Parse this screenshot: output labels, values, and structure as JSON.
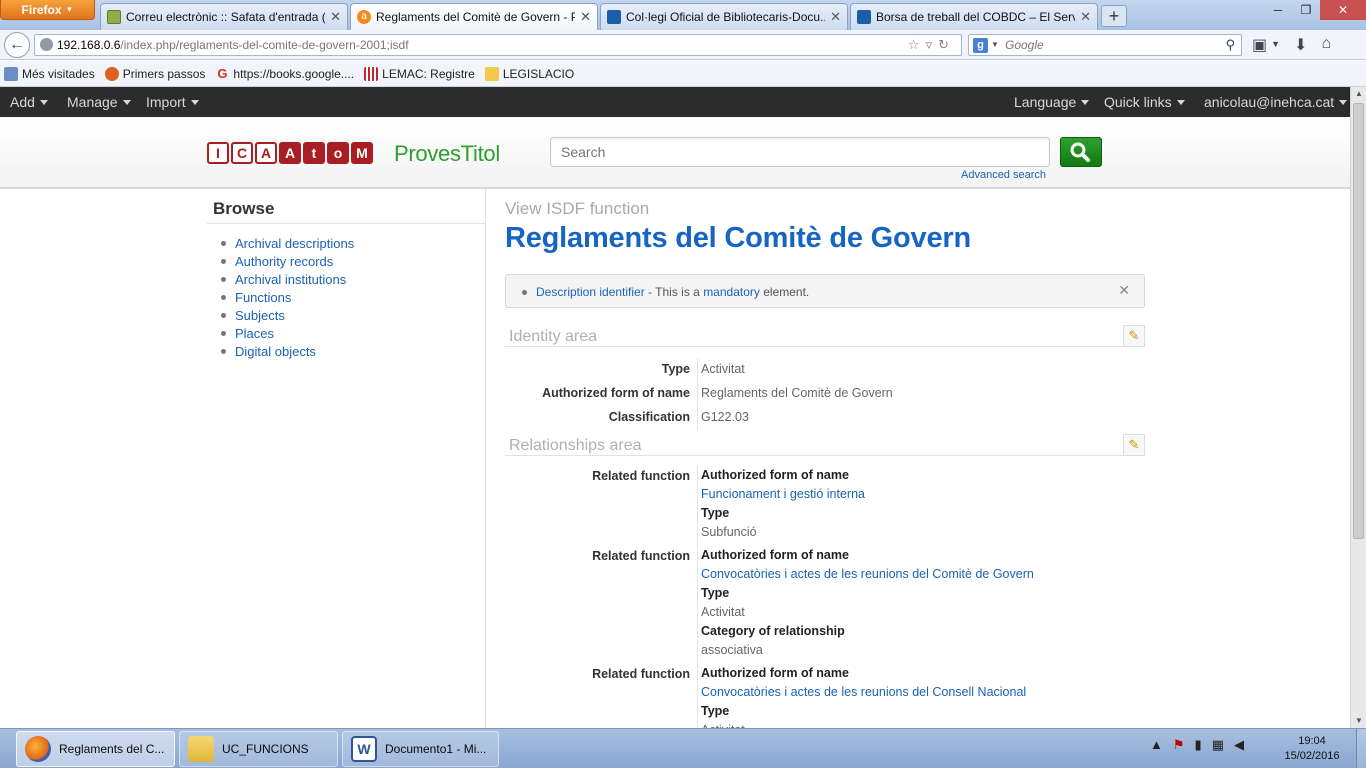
{
  "browser": {
    "menu_button": "Firefox",
    "tabs": [
      {
        "title": "Correu electrònic :: Safata d'entrada (..."
      },
      {
        "title": "Reglaments del Comitè de Govern - P..."
      },
      {
        "title": "Col·legi Oficial de Bibliotecaris-Docu..."
      },
      {
        "title": "Borsa de treball del COBDC – El Servei..."
      }
    ],
    "url_host": "192.168.0.6",
    "url_path": "/index.php/reglaments-del-comite-de-govern-2001;isdf",
    "search_engine_placeholder": "Google",
    "bookmarks": [
      {
        "label": "Més visitades"
      },
      {
        "label": "Primers passos"
      },
      {
        "label": "https://books.google...."
      },
      {
        "label": "LEMAC: Registre"
      },
      {
        "label": "LEGISLACIO"
      }
    ]
  },
  "atom": {
    "topbar": {
      "add": "Add",
      "manage": "Manage",
      "import": "Import",
      "language": "Language",
      "quick_links": "Quick links",
      "user": "anicolau@inehca.cat"
    },
    "logo_letters": [
      "I",
      "C",
      "A",
      "A",
      "t",
      "o",
      "M"
    ],
    "site_name": "ProvesTitol",
    "search_placeholder": "Search",
    "advanced_search": "Advanced search",
    "browse": {
      "title": "Browse",
      "items": [
        "Archival descriptions",
        "Authority records",
        "Archival institutions",
        "Functions",
        "Subjects",
        "Places",
        "Digital objects"
      ]
    },
    "main": {
      "subtitle": "View ISDF function",
      "title": "Reglaments del Comitè de Govern",
      "alert": {
        "link": "Description identifier",
        "mid": " - This is a ",
        "link2": "mandatory",
        "end": " element."
      },
      "identity_area": {
        "title": "Identity area",
        "fields": [
          {
            "label": "Type",
            "value": "Activitat"
          },
          {
            "label": "Authorized form of name",
            "value": "Reglaments del Comitè de Govern"
          },
          {
            "label": "Classification",
            "value": "G122.03"
          }
        ]
      },
      "relationships_area": {
        "title": "Relationships area",
        "label": "Related function",
        "h_name": "Authorized form of name",
        "h_type": "Type",
        "h_category": "Category of relationship",
        "relations": [
          {
            "name": "Funcionament i gestió interna",
            "type": "Subfunció"
          },
          {
            "name": "Convocatòries i actes de les reunions del Comitè de Govern",
            "type": "Activitat",
            "category": "associativa"
          },
          {
            "name": "Convocatòries i actes de les reunions del Consell Nacional",
            "type": "Activitat"
          }
        ]
      }
    }
  },
  "taskbar": {
    "buttons": [
      {
        "label": "Reglaments del C..."
      },
      {
        "label": "UC_FUNCIONS"
      },
      {
        "label": "Documento1 - Mi..."
      }
    ],
    "time": "19:04",
    "date": "15/02/2016"
  }
}
